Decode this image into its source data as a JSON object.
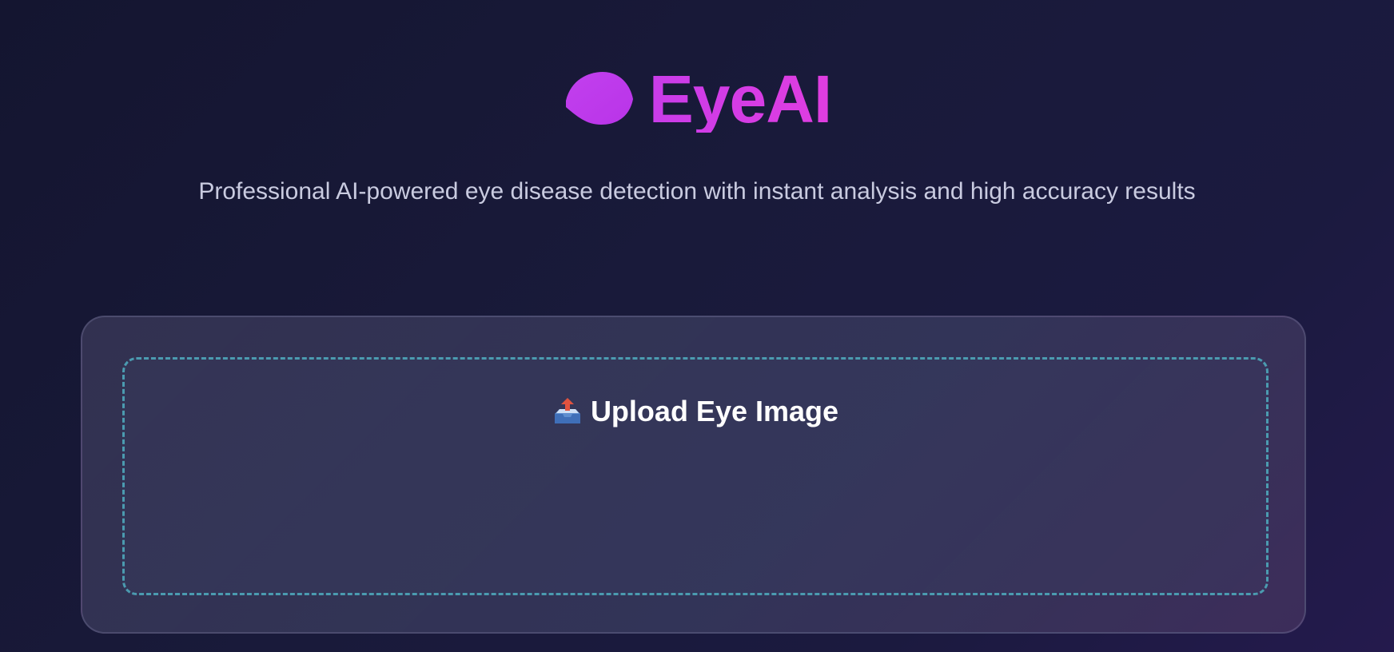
{
  "header": {
    "brand_icon": "eye-icon",
    "title": "EyeAI",
    "subtitle": "Professional AI-powered eye disease detection with instant analysis and high accuracy results"
  },
  "upload": {
    "icon": "outbox-tray-icon",
    "label": "Upload Eye Image"
  },
  "colors": {
    "background": "#171835",
    "accent": "#d13de6",
    "dropzone_border": "#4b9bb0"
  }
}
